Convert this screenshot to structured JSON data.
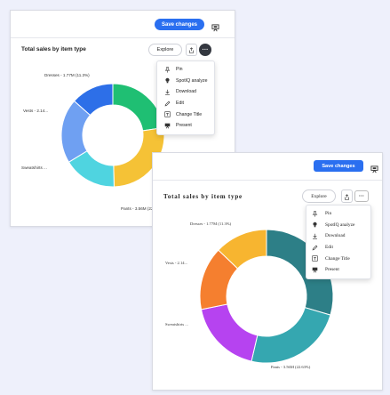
{
  "cards": [
    {
      "save_label": "Save changes",
      "title": "Total sales by item type",
      "explore_label": "Explore",
      "more_label": "···",
      "menu": [
        {
          "label": "Pin",
          "icon": "pin-icon"
        },
        {
          "label": "SpotIQ analyze",
          "icon": "bulb-icon"
        },
        {
          "label": "Download",
          "icon": "download-icon"
        },
        {
          "label": "Edit",
          "icon": "pencil-icon"
        },
        {
          "label": "Change Title",
          "icon": "title-icon"
        },
        {
          "label": "Present",
          "icon": "present-icon"
        }
      ],
      "labels": {
        "dresses": "Dresses - 1.77M (11.3%)",
        "vests": "Vests - 2.14...",
        "sweatshirts": "Sweatshirts ...",
        "pants": "Pants - 3.56M (22.63%)"
      },
      "colors": [
        "#1fbf73",
        "#f5c236",
        "#4fd4e0",
        "#6fa0f2",
        "#2d6fe8"
      ]
    },
    {
      "save_label": "Save changes",
      "title": "Total sales by item type",
      "explore_label": "Explore",
      "more_label": "···",
      "menu": [
        {
          "label": "Pin",
          "icon": "pin-icon"
        },
        {
          "label": "SpotIQ analyze",
          "icon": "bulb-icon"
        },
        {
          "label": "Download",
          "icon": "download-icon"
        },
        {
          "label": "Edit",
          "icon": "pencil-icon"
        },
        {
          "label": "Change Title",
          "icon": "title-icon"
        },
        {
          "label": "Present",
          "icon": "present-icon"
        }
      ],
      "labels": {
        "dresses": "Dresses - 1.77M (11.3%)",
        "vests": "Vests - 2.14...",
        "sweatshirts": "Sweatshirts ...",
        "pants": "Pants - 3.56M (22.63%)"
      },
      "colors": [
        "#2d7f87",
        "#35a7b0",
        "#b643f0",
        "#f57f2f",
        "#f7b530"
      ]
    }
  ],
  "chart_data": [
    {
      "type": "pie",
      "title": "Total sales by item type",
      "categories": [
        "(unlabeled)",
        "Pants",
        "Sweatshirts",
        "Vests",
        "Dresses"
      ],
      "values": [
        19,
        22.63,
        14,
        17,
        11.3
      ],
      "value_labels": [
        "",
        "3.56M",
        "",
        "2.14...",
        "1.77M"
      ]
    },
    {
      "type": "pie",
      "title": "Total sales by item type",
      "categories": [
        "(unlabeled)",
        "Pants",
        "Sweatshirts",
        "Vests",
        "Dresses"
      ],
      "values": [
        26,
        21.2,
        16,
        13.5,
        11.3
      ],
      "value_labels": [
        "",
        "3.56M",
        "",
        "2.14...",
        "1.77M"
      ]
    }
  ]
}
